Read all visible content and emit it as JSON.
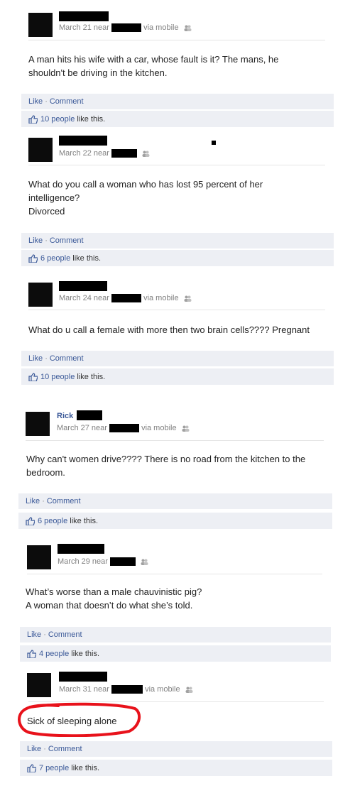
{
  "posts": [
    {
      "name": "",
      "date": "March 21 near",
      "via": "via mobile",
      "text": "A man hits his wife with a car, whose fault is it? The mans, he shouldn't be driving in the kitchen.",
      "like": "Like",
      "comment": "Comment",
      "likes_count": "10 people",
      "likes_suffix": "like this."
    },
    {
      "name": "",
      "date": "March 22 near",
      "via": "",
      "text": "What do you call a woman who has lost 95 percent of her intelligence?\nDivorced",
      "like": "Like",
      "comment": "Comment",
      "likes_count": "6 people",
      "likes_suffix": "like this."
    },
    {
      "name": "",
      "date": "March 24 near",
      "via": "via mobile",
      "text": "What do u call a female with more then two brain cells???? Pregnant",
      "like": "Like",
      "comment": "Comment",
      "likes_count": "10 people",
      "likes_suffix": "like this."
    },
    {
      "name": "Rick",
      "date": "March 27 near",
      "via": "via mobile",
      "text": "Why can't women drive???? There is no road from the kitchen to the bedroom.",
      "like": "Like",
      "comment": "Comment",
      "likes_count": "6 people",
      "likes_suffix": "like this."
    },
    {
      "name": "",
      "date": "March 29 near",
      "via": "",
      "text": "What’s worse than a male chauvinistic pig?\nA woman that doesn’t do what she’s told.",
      "like": "Like",
      "comment": "Comment",
      "likes_count": "4 people",
      "likes_suffix": "like this."
    },
    {
      "name": "",
      "date": "March 31 near",
      "via": "via mobile",
      "text": "Sick of sleeping alone",
      "like": "Like",
      "comment": "Comment",
      "likes_count": "7 people",
      "likes_suffix": "like this."
    }
  ],
  "highlight_color": "#e8121b",
  "link_color": "#3b5998"
}
